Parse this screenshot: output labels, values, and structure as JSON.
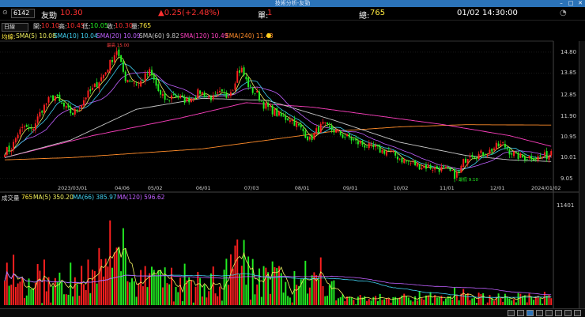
{
  "window": {
    "title": "技術分析-友勁"
  },
  "header": {
    "code": "6142",
    "name": "友勁",
    "price": "10.30",
    "change": "▲0.25(+2.48%)",
    "unit_label": "單:",
    "unit_value": "1",
    "total_label": "總:",
    "total_value": "765",
    "datetime": "01/02 14:30:00"
  },
  "toolbar": {
    "period": "日線",
    "open_label": "開:",
    "open": "10.10",
    "high_label": "高:",
    "high": "10.45",
    "low_label": "低:",
    "low": "10.05",
    "close_label": "收:",
    "close": "10.30",
    "vol_label": "量:",
    "vol": "765"
  },
  "price_legend": {
    "title": "均線:",
    "sma5": "SMA(5) 10.08",
    "sma10": "SMA(10) 10.04",
    "sma20": "SMA(20) 10.09",
    "sma60": "SMA(60) 9.82",
    "sma120": "SMA(120) 10.49",
    "sma240": "SMA(240) 11.48"
  },
  "volume_legend": {
    "title": "成交量",
    "vol": "765",
    "ma5": "MA(5) 350.20",
    "ma66": "MA(66) 385.97",
    "ma120": "MA(120) 596.62"
  },
  "price_axis": [
    "14.80",
    "13.85",
    "12.85",
    "11.90",
    "10.95",
    "10.01",
    "9.05"
  ],
  "price_axis_value_labels": [
    14.8,
    13.85,
    12.85,
    11.9,
    10.95,
    10.01,
    9.05
  ],
  "volume_axis": [
    "11401"
  ],
  "date_axis": [
    "2023/03/01",
    "04/06",
    "05/02",
    "06/01",
    "07/03",
    "08/01",
    "09/01",
    "10/02",
    "11/01",
    "12/01",
    "2024/01/02"
  ],
  "annotations": {
    "high_mark": "最高 15.00",
    "low_mark": "最低 9.10"
  },
  "colors": {
    "up": "#ff2020",
    "down": "#22ee22",
    "sma5": "#f0f060",
    "sma10": "#40d0f0",
    "sma20": "#c060ff",
    "sma60": "#c8c8c8",
    "sma120": "#ff40c0",
    "sma240": "#ff8c2a",
    "titlebar": "#2b73b8"
  },
  "chart_data": {
    "type": "candlestick",
    "title": "",
    "x_range": [
      "2023/02/22",
      "2024/01/02"
    ],
    "ylim": [
      8.9,
      15.3
    ],
    "price_path": [
      [
        0,
        10.3
      ],
      [
        3,
        10.4
      ],
      [
        6,
        11.1
      ],
      [
        9,
        11.4
      ],
      [
        12,
        11.2
      ],
      [
        14,
        11.6
      ],
      [
        17,
        12.2
      ],
      [
        20,
        12.6
      ],
      [
        23,
        12.8
      ],
      [
        25,
        12.5
      ],
      [
        28,
        12.2
      ],
      [
        31,
        12.0
      ],
      [
        34,
        12.3
      ],
      [
        37,
        12.8
      ],
      [
        40,
        13.1
      ],
      [
        43,
        13.5
      ],
      [
        46,
        13.9
      ],
      [
        49,
        14.5
      ],
      [
        51,
        14.9
      ],
      [
        53,
        14.2
      ],
      [
        55,
        13.6
      ],
      [
        58,
        13.5
      ],
      [
        61,
        13.3
      ],
      [
        63,
        13.6
      ],
      [
        66,
        13.9
      ],
      [
        68,
        13.5
      ],
      [
        71,
        12.8
      ],
      [
        74,
        12.6
      ],
      [
        77,
        12.9
      ],
      [
        80,
        12.7
      ],
      [
        83,
        12.6
      ],
      [
        86,
        12.8
      ],
      [
        89,
        13.0
      ],
      [
        92,
        12.8
      ],
      [
        95,
        12.7
      ],
      [
        98,
        12.9
      ],
      [
        101,
        12.8
      ],
      [
        104,
        13.2
      ],
      [
        106,
        13.9
      ],
      [
        108,
        14.0
      ],
      [
        110,
        13.5
      ],
      [
        112,
        13.1
      ],
      [
        115,
        12.9
      ],
      [
        118,
        12.4
      ],
      [
        121,
        12.2
      ],
      [
        124,
        12.0
      ],
      [
        127,
        11.8
      ],
      [
        130,
        11.8
      ],
      [
        133,
        11.5
      ],
      [
        136,
        11.2
      ],
      [
        139,
        10.8
      ],
      [
        142,
        11.2
      ],
      [
        145,
        11.5
      ],
      [
        148,
        11.3
      ],
      [
        151,
        11.2
      ],
      [
        154,
        11.0
      ],
      [
        157,
        10.9
      ],
      [
        160,
        10.7
      ],
      [
        163,
        10.6
      ],
      [
        166,
        10.5
      ],
      [
        169,
        10.4
      ],
      [
        172,
        10.3
      ],
      [
        175,
        10.3
      ],
      [
        178,
        10.1
      ],
      [
        181,
        9.9
      ],
      [
        184,
        9.8
      ],
      [
        187,
        9.7
      ],
      [
        190,
        9.6
      ],
      [
        193,
        9.6
      ],
      [
        196,
        9.5
      ],
      [
        199,
        9.5
      ],
      [
        202,
        9.4
      ],
      [
        205,
        9.2
      ],
      [
        207,
        9.3
      ],
      [
        209,
        9.8
      ],
      [
        212,
        10.2
      ],
      [
        215,
        10.1
      ],
      [
        218,
        10.2
      ],
      [
        221,
        10.3
      ],
      [
        224,
        10.5
      ],
      [
        227,
        10.6
      ],
      [
        230,
        10.3
      ],
      [
        233,
        10.1
      ],
      [
        236,
        10.0
      ],
      [
        239,
        10.05
      ],
      [
        242,
        10.0
      ],
      [
        245,
        10.05
      ],
      [
        248,
        10.1
      ],
      [
        250,
        10.3
      ]
    ],
    "sma240_path": [
      [
        0,
        9.9
      ],
      [
        30,
        10.0
      ],
      [
        60,
        10.2
      ],
      [
        90,
        10.4
      ],
      [
        120,
        10.8
      ],
      [
        150,
        11.2
      ],
      [
        180,
        11.4
      ],
      [
        210,
        11.5
      ],
      [
        250,
        11.48
      ]
    ],
    "sma120_path": [
      [
        0,
        10.0
      ],
      [
        40,
        11.0
      ],
      [
        80,
        11.8
      ],
      [
        110,
        12.5
      ],
      [
        140,
        12.3
      ],
      [
        170,
        11.9
      ],
      [
        200,
        11.5
      ],
      [
        230,
        11.0
      ],
      [
        250,
        10.49
      ]
    ],
    "sma60_path": [
      [
        0,
        10.0
      ],
      [
        30,
        10.8
      ],
      [
        60,
        12.2
      ],
      [
        90,
        12.7
      ],
      [
        120,
        12.6
      ],
      [
        150,
        11.7
      ],
      [
        180,
        10.7
      ],
      [
        210,
        10.1
      ],
      [
        230,
        9.9
      ],
      [
        250,
        9.82
      ]
    ],
    "volume": {
      "ylim": [
        0,
        11401
      ],
      "values": [
        765
      ]
    }
  }
}
